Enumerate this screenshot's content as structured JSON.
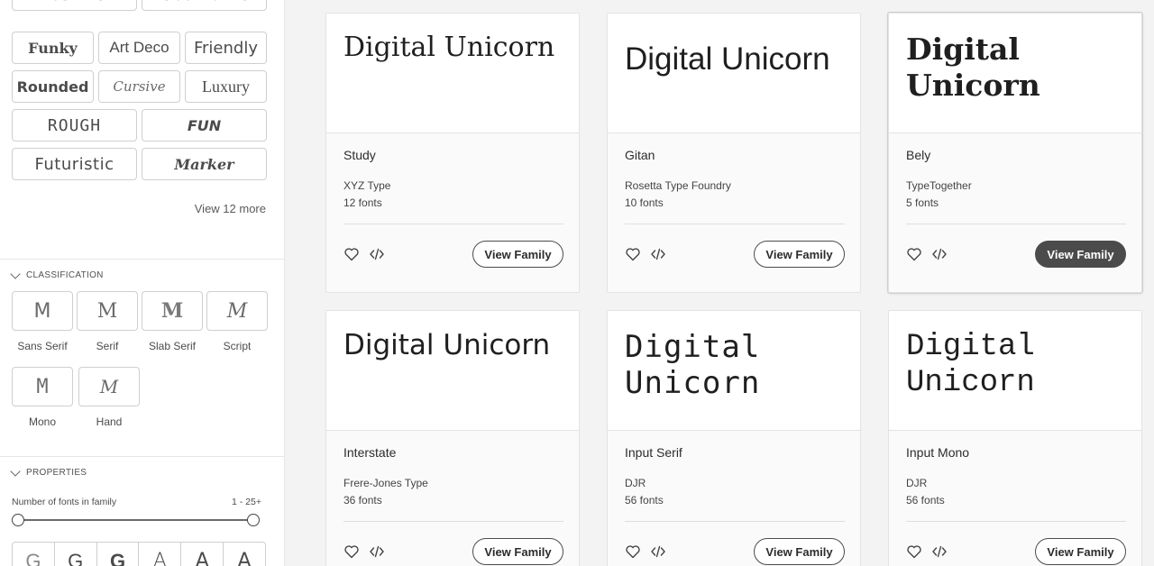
{
  "sidebar": {
    "tags": [
      "Brush Pen",
      "Geometric",
      "Funky",
      "Art Deco",
      "Friendly",
      "Rounded",
      "Cursive",
      "Luxury",
      "ROUGH",
      "FUN",
      "Futuristic",
      "Marker"
    ],
    "view_more": "View 12 more",
    "classification": {
      "title": "CLASSIFICATION",
      "items": [
        {
          "glyph": "M",
          "label": "Sans Serif"
        },
        {
          "glyph": "M",
          "label": "Serif"
        },
        {
          "glyph": "M",
          "label": "Slab Serif"
        },
        {
          "glyph": "M",
          "label": "Script"
        },
        {
          "glyph": "M",
          "label": "Mono"
        },
        {
          "glyph": "M",
          "label": "Hand"
        }
      ]
    },
    "properties": {
      "title": "PROPERTIES",
      "fonts_in_family_label": "Number of fonts in family",
      "fonts_in_family_range": "1 - 25+",
      "weights": [
        "G",
        "G",
        "G",
        "A",
        "A",
        "A"
      ]
    }
  },
  "cards": [
    {
      "preview": "Digital Unicorn",
      "name": "Study",
      "foundry": "XYZ Type",
      "count": "12 fonts",
      "button": "View Family"
    },
    {
      "preview": "Digital Unicorn",
      "name": "Gitan",
      "foundry": "Rosetta Type Foundry",
      "count": "10 fonts",
      "button": "View Family"
    },
    {
      "preview": "Digital Unicorn",
      "name": "Bely",
      "foundry": "TypeTogether",
      "count": "5 fonts",
      "button": "View Family"
    },
    {
      "preview": "Digital Unicorn",
      "name": "Interstate",
      "foundry": "Frere-Jones Type",
      "count": "36 fonts",
      "button": "View Family"
    },
    {
      "preview": "Digital Unicorn",
      "name": "Input Serif",
      "foundry": "DJR",
      "count": "56 fonts",
      "button": "View Family"
    },
    {
      "preview": "Digital Unicorn",
      "name": "Input Mono",
      "foundry": "DJR",
      "count": "56 fonts",
      "button": "View Family"
    }
  ],
  "icons": {
    "favorite": "heart-icon",
    "embed": "code-icon",
    "collapse": "chevron-down-icon"
  },
  "colors": {
    "active_button": "#4b4b4b",
    "page_bg": "#f3f3f3"
  }
}
